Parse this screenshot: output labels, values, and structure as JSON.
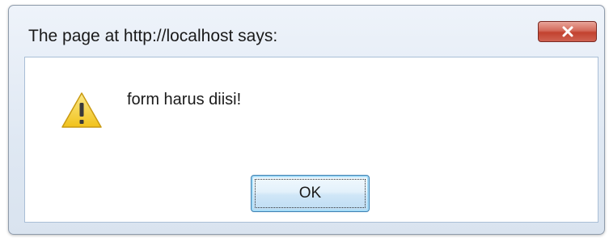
{
  "dialog": {
    "title": "The page at http://localhost says:",
    "message": "form harus diisi!",
    "ok_label": "OK",
    "close_icon": "close-x-icon",
    "message_icon": "warning-icon"
  },
  "colors": {
    "title_bar": "#dfe8f3",
    "close_button": "#c2422f",
    "ok_border": "#3c7fb1",
    "warning_fill": "#f6d23a"
  }
}
